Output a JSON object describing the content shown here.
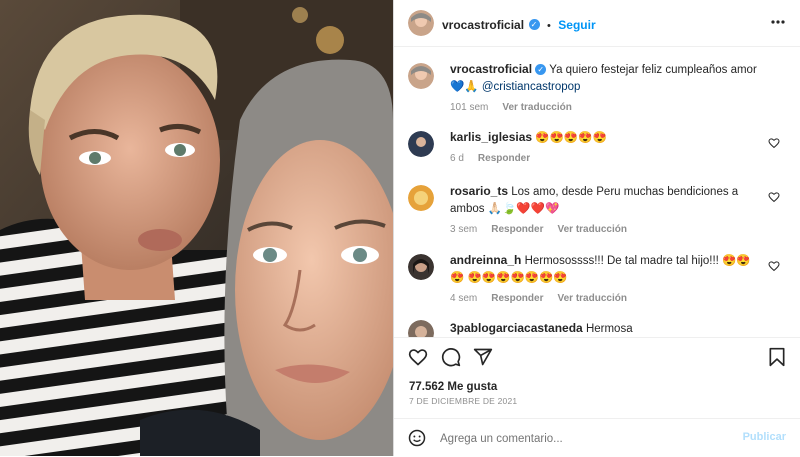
{
  "post": {
    "username": "vrocastroficial",
    "follow_label": "Seguir",
    "caption_user": "vrocastroficial",
    "caption_text": "Ya quiero festejar feliz cumpleaños amor 💙🙏",
    "caption_mention": "@cristiancastropop",
    "caption_time": "101 sem",
    "caption_translate": "Ver traducción"
  },
  "comments": [
    {
      "user": "karlis_iglesias",
      "text": "😍😍😍😍😍",
      "time": "6 d",
      "reply": "Responder",
      "translate": ""
    },
    {
      "user": "rosario_ts",
      "text": "Los amo, desde Peru muchas bendiciones a ambos 🙏🏻🍃❤️❤️💖",
      "time": "3 sem",
      "reply": "Responder",
      "translate": "Ver traducción"
    },
    {
      "user": "andreinna_h",
      "text": "Hermosossss!!! De tal madre tal hijo!!! 😍😍😍 😍😍😍😍😍😍😍",
      "time": "4 sem",
      "reply": "Responder",
      "translate": "Ver traducción"
    },
    {
      "user": "3pablogarciacastaneda",
      "text": "Hermosa",
      "time": "",
      "reply": "",
      "translate": ""
    }
  ],
  "stats": {
    "likes": "77.562 Me gusta",
    "date": "7 DE DICIEMBRE DE 2021"
  },
  "comment_box": {
    "placeholder": "Agrega un comentario...",
    "publish": "Publicar"
  },
  "icons": [
    "more-options-icon",
    "like-icon",
    "comment-icon",
    "share-icon",
    "save-icon",
    "emoji-icon",
    "verified-icon"
  ]
}
